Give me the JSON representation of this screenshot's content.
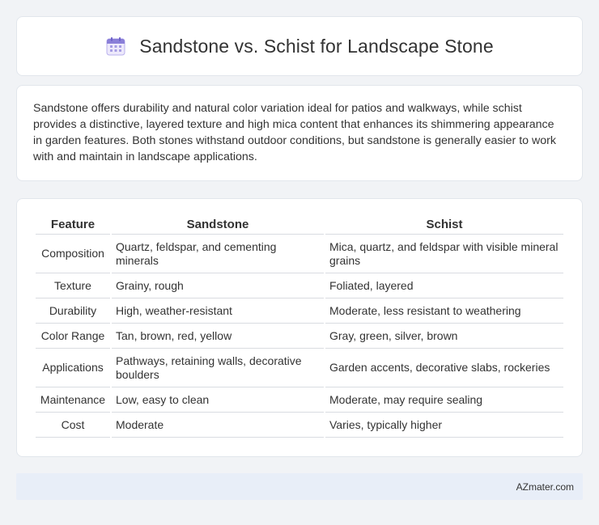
{
  "header": {
    "title": "Sandstone vs. Schist for Landscape Stone",
    "icon": "calendar-icon"
  },
  "summary": {
    "text": "Sandstone offers durability and natural color variation ideal for patios and walkways, while schist provides a distinctive, layered texture and high mica content that enhances its shimmering appearance in garden features. Both stones withstand outdoor conditions, but sandstone is generally easier to work with and maintain in landscape applications."
  },
  "table": {
    "headers": [
      "Feature",
      "Sandstone",
      "Schist"
    ],
    "rows": [
      [
        "Composition",
        "Quartz, feldspar, and cementing minerals",
        "Mica, quartz, and feldspar with visible mineral grains"
      ],
      [
        "Texture",
        "Grainy, rough",
        "Foliated, layered"
      ],
      [
        "Durability",
        "High, weather-resistant",
        "Moderate, less resistant to weathering"
      ],
      [
        "Color Range",
        "Tan, brown, red, yellow",
        "Gray, green, silver, brown"
      ],
      [
        "Applications",
        "Pathways, retaining walls, decorative boulders",
        "Garden accents, decorative slabs, rockeries"
      ],
      [
        "Maintenance",
        "Low, easy to clean",
        "Moderate, may require sealing"
      ],
      [
        "Cost",
        "Moderate",
        "Varies, typically higher"
      ]
    ]
  },
  "footer": {
    "text": "AZmater.com"
  },
  "colors": {
    "page_background": "#f1f3f6",
    "card_background": "#ffffff",
    "footer_background": "#e8eef8",
    "icon_accent": "#8a7fd8"
  }
}
